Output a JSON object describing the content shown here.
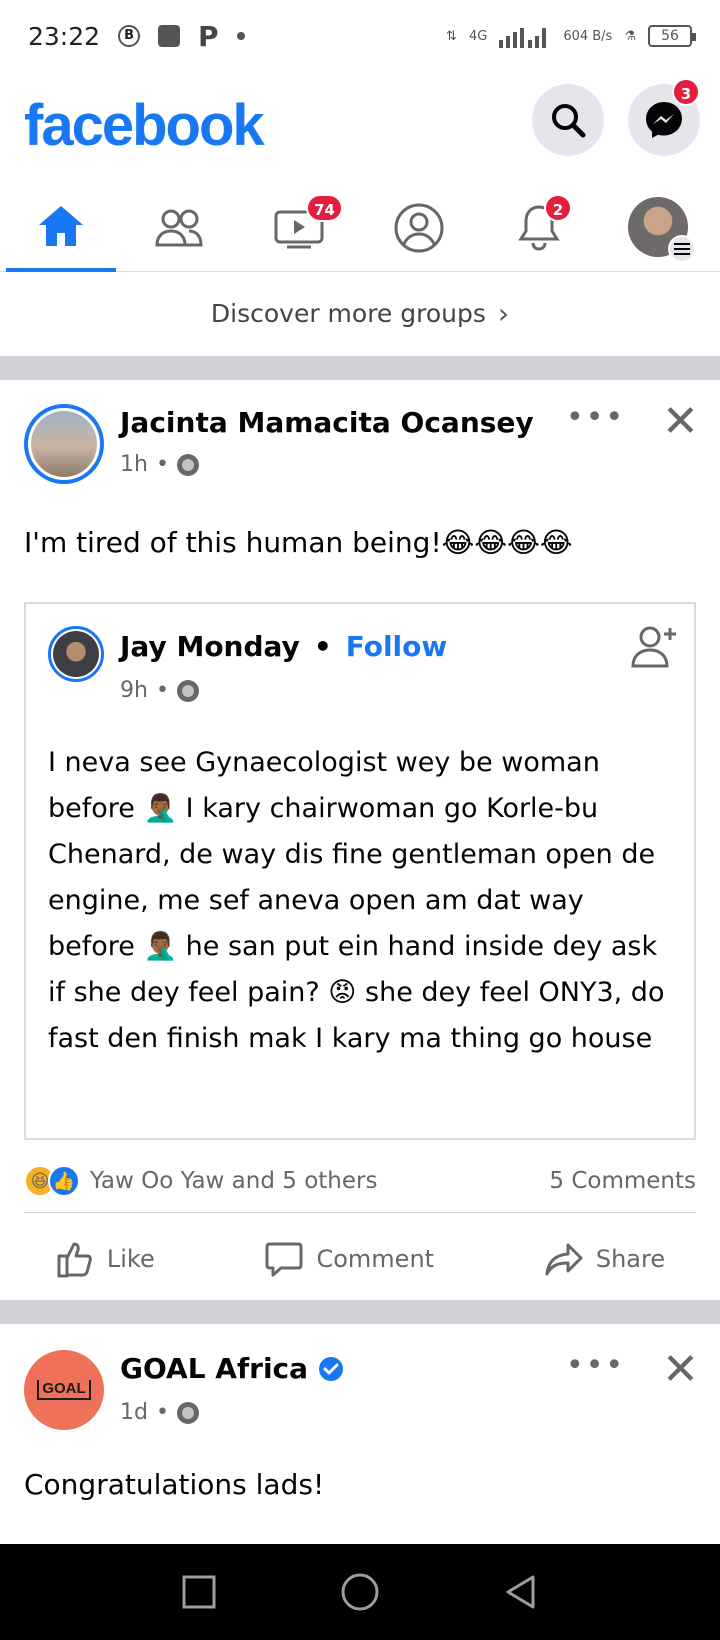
{
  "status_bar": {
    "time": "23:22",
    "network": "4G",
    "speed": "604 B/s",
    "battery": "56"
  },
  "header": {
    "logo": "facebook",
    "messenger_badge": "3",
    "brand_color": "#1877f2"
  },
  "nav": {
    "watch_badge": "74",
    "notifications_badge": "2"
  },
  "discover": {
    "label": "Discover more groups"
  },
  "post1": {
    "author": "Jacinta Mamacita Ocansey",
    "time": "1h",
    "text": "I'm tired of this human being!😂😂😂😂",
    "shared": {
      "author": "Jay Monday",
      "separator": "•",
      "follow": "Follow",
      "time": "9h",
      "text": "I neva see Gynaecologist wey be woman before 🤦🏾‍♂️ I kary chairwoman go Korle-bu Chenard, de way dis fine gentleman open de engine, me sef aneva open am dat way before 🤦🏾‍♂️ he san put ein hand inside dey ask if she dey feel pain? 😡 she dey feel ONY3, do fast den finish mak I kary ma thing go house"
    },
    "reactions_text": "Yaw Oo Yaw and 5 others",
    "comments": "5 Comments",
    "actions": {
      "like": "Like",
      "comment": "Comment",
      "share": "Share"
    }
  },
  "post2": {
    "author": "GOAL Africa",
    "avatar_text": "GOAL",
    "time": "1d",
    "text": "Congratulations lads!"
  },
  "icons": {
    "search": "search-icon",
    "messenger": "messenger-icon",
    "home": "home-icon",
    "friends": "friends-icon",
    "watch": "watch-icon",
    "profile": "profile-icon",
    "notifications": "bell-icon",
    "menu": "menu-icon"
  }
}
